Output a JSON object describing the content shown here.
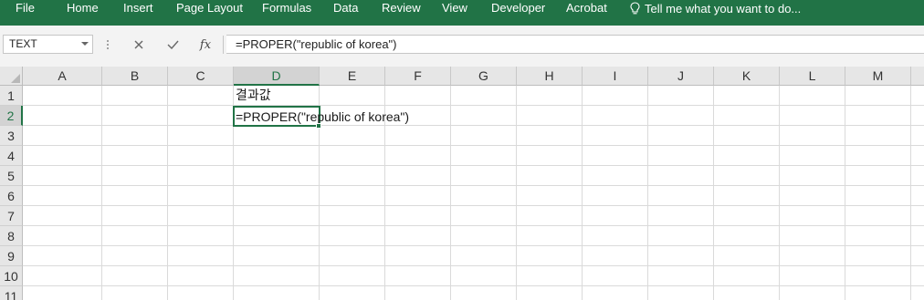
{
  "menu": {
    "items": [
      "File",
      "Home",
      "Insert",
      "Page Layout",
      "Formulas",
      "Data",
      "Review",
      "View",
      "Developer",
      "Acrobat"
    ],
    "tell_me": "Tell me what you want to do..."
  },
  "formula_bar": {
    "name_box": "TEXT",
    "cancel_icon": "close-icon",
    "enter_icon": "check-icon",
    "fx_label": "fx",
    "formula": "=PROPER(\"republic of korea\")"
  },
  "sheet": {
    "columns": [
      "A",
      "B",
      "C",
      "D",
      "E",
      "F",
      "G",
      "H",
      "I",
      "J",
      "K",
      "L",
      "M"
    ],
    "rows": [
      "1",
      "2",
      "3",
      "4",
      "5",
      "6",
      "7",
      "8",
      "9",
      "10",
      "11"
    ],
    "selected_column": "D",
    "selected_row": "2",
    "cells": {
      "D1": "결과값",
      "D2": "=PROPER(\"republic of korea\")"
    }
  },
  "colors": {
    "ribbon": "#217346",
    "selection": "#217346",
    "header_bg": "#e6e6e6",
    "gridline": "#dadada"
  }
}
